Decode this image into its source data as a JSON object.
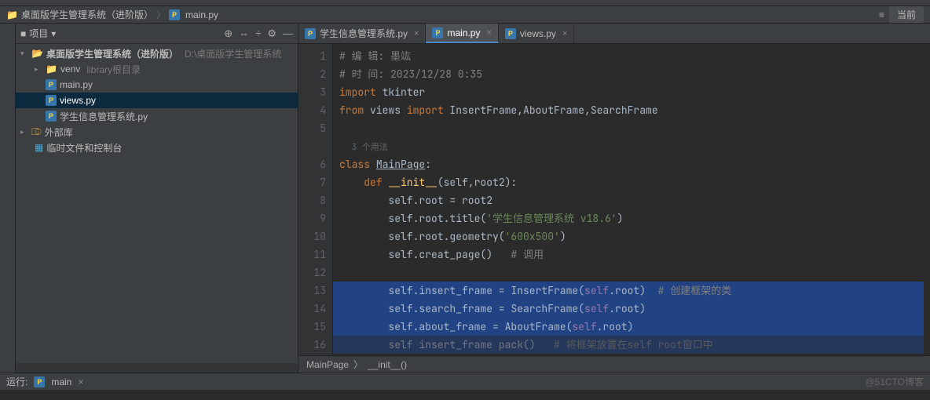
{
  "breadcrumb": {
    "root": "桌面版学生管理系统（进阶版）",
    "file": "main.py"
  },
  "topright": {
    "btn": "当前"
  },
  "sidebar": {
    "title": "项目",
    "tree": {
      "root": "桌面版学生管理系统（进阶版）",
      "root_path": "D:\\桌面版学生管理系统",
      "venv": "venv",
      "venv_hint": "library根目录",
      "main": "main.py",
      "views": "views.py",
      "sys": "学生信息管理系统.py",
      "extlib": "外部库",
      "scratch": "临时文件和控制台"
    }
  },
  "tabs": {
    "t1": "学生信息管理系统.py",
    "t2": "main.py",
    "t3": "views.py"
  },
  "code": {
    "l1_cm": "# 编 辑: 墨竑",
    "l2_cm": "# 时 间: 2023/12/28 0:35",
    "l3_kw": "import",
    "l3_mod": " tkinter",
    "l4_kw1": "from",
    "l4_mod": " views ",
    "l4_kw2": "import",
    "l4_names": " InsertFrame,AboutFrame,SearchFrame",
    "hint": "3 个用法",
    "l6_kw": "class ",
    "l6_name": "MainPage",
    "l6_colon": ":",
    "l7_kw": "def ",
    "l7_fn": "__init__",
    "l7_sig": "(self,root2):",
    "l8": "        self.root = root2",
    "l9_a": "        self.root.title(",
    "l9_s": "'学生信息管理系统 v18.6'",
    "l9_b": ")",
    "l10_a": "        self.root.geometry(",
    "l10_s": "'600x500'",
    "l10_b": ")",
    "l11_a": "        self.creat_page()   ",
    "l11_cm": "# 调用",
    "l13_a": "        self.insert_frame = InsertFrame(",
    "l13_b": "self",
    "l13_c": ".root)  ",
    "l13_cm": "# 创建框架的类",
    "l14_a": "        self.search_frame = SearchFrame(",
    "l14_b": "self",
    "l14_c": ".root)",
    "l15_a": "        self.about_frame = AboutFrame(",
    "l15_b": "self",
    "l15_c": ".root)",
    "l16_a": "        self insert_frame pack()   ",
    "l16_cm": "# 将框架放置在self root窗口中"
  },
  "crumb2": {
    "a": "MainPage",
    "b": "__init__()"
  },
  "bottom": {
    "run": "运行:",
    "name": "main",
    "watermark": "@51CTO博客"
  },
  "line_numbers": [
    "1",
    "2",
    "3",
    "4",
    "5",
    "",
    "6",
    "7",
    "8",
    "9",
    "10",
    "11",
    "12",
    "13",
    "14",
    "15",
    "16"
  ]
}
